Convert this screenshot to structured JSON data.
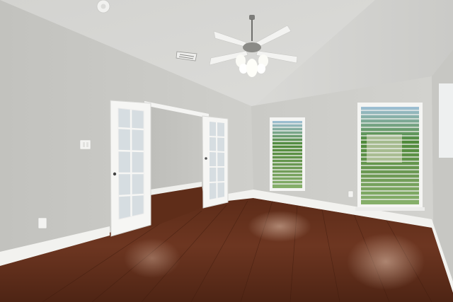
{
  "scene": {
    "kind": "photo",
    "subject": "empty room",
    "colors": {
      "wall_left": "#c9c9c5",
      "wall_back": "#cdcdc9",
      "ceiling": "#d6d6d3",
      "floor": "#6a3520",
      "trim": "#f4f4f2",
      "glass": "#dfe6ea",
      "foliage": "#4f8a3a"
    }
  }
}
